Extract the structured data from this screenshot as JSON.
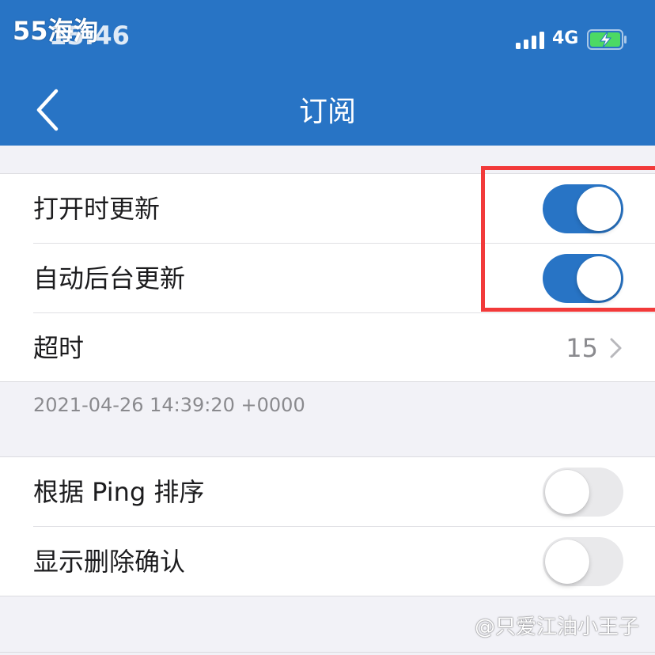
{
  "status_bar": {
    "time": "15:46",
    "network": "4G",
    "watermark": "55海淘"
  },
  "nav": {
    "title": "订阅",
    "back_icon": "chevron-left-icon"
  },
  "group1": {
    "rows": [
      {
        "label": "打开时更新",
        "toggle": true
      },
      {
        "label": "自动后台更新",
        "toggle": true
      },
      {
        "label": "超时",
        "value": "15"
      }
    ]
  },
  "timestamp": "2021-04-26 14:39:20 +0000",
  "group2": {
    "rows": [
      {
        "label": "根据 Ping 排序",
        "toggle": false
      },
      {
        "label": "显示删除确认",
        "toggle": false
      }
    ]
  },
  "watermark_bottom": "@只爱江油小王子",
  "colors": {
    "accent": "#2874c5",
    "highlight": "#f23a3a",
    "toggle_off": "#e9e9eb",
    "background": "#f2f2f7"
  }
}
